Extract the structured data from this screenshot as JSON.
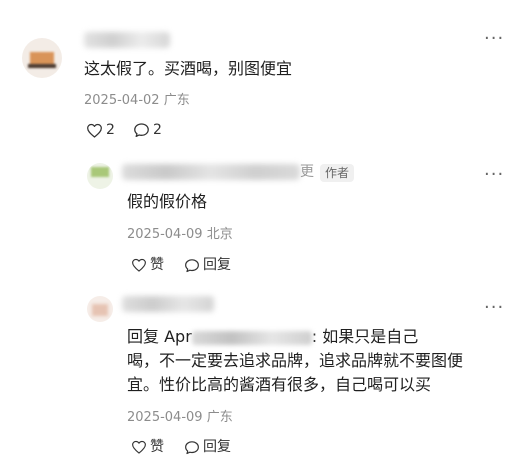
{
  "comments": [
    {
      "name_visible": "",
      "text": "这太假了。买酒喝，别图便宜",
      "date": "2025-04-02",
      "location": "广东",
      "like_count": "2",
      "reply_count": "2"
    },
    {
      "name_visible": "更",
      "author_tag": "作者",
      "text": "假的假价格",
      "date": "2025-04-09",
      "location": "北京",
      "like_label": "赞",
      "reply_label": "回复"
    },
    {
      "name_visible": "",
      "reply_prefix": "回复 Apr",
      "text_after": ": 如果只是自己",
      "text_line2": "喝，不一定要去追求品牌，追求品牌就不要图便",
      "text_line3": "宜。性价比高的酱酒有很多，自己喝可以买",
      "date": "2025-04-09",
      "location": "广东",
      "like_label": "赞",
      "reply_label": "回复"
    }
  ],
  "more_label": "···"
}
